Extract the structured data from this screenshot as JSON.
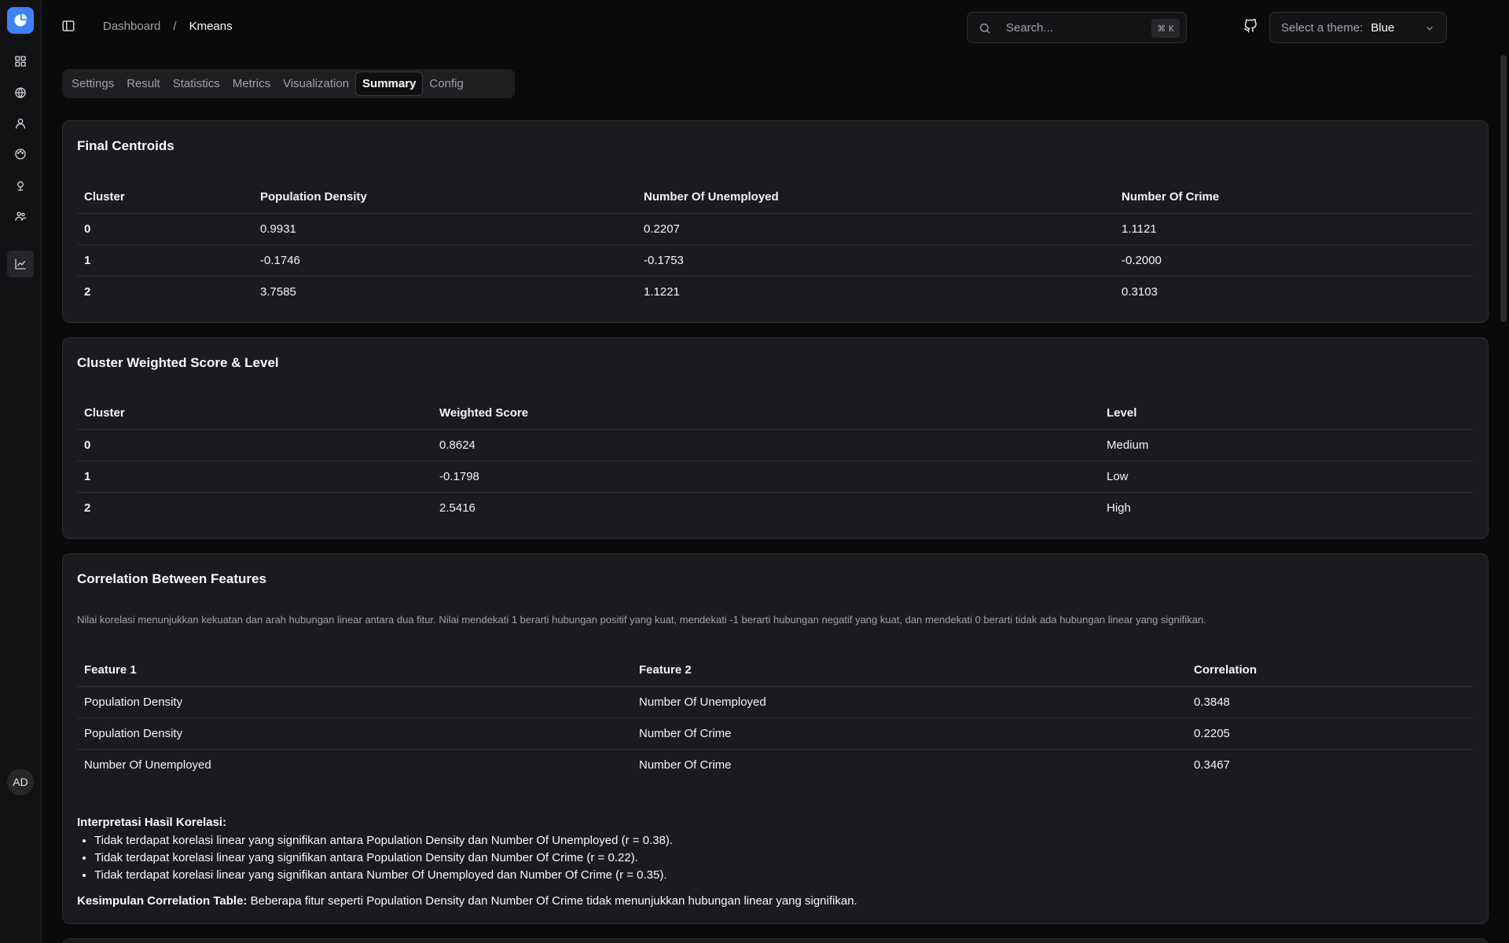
{
  "sidebar": {
    "nav": [
      "dashboard-icon",
      "globe-icon",
      "user-icon",
      "palette-icon",
      "map-pin-icon",
      "users-icon",
      "chart-line-icon"
    ],
    "avatar": "AD"
  },
  "header": {
    "breadcrumb": [
      "Dashboard",
      "Kmeans"
    ],
    "search_placeholder": "Search...",
    "search_kbd": "⌘ K",
    "theme_label": "Select a theme:",
    "theme_value": "Blue"
  },
  "tabs": [
    "Settings",
    "Result",
    "Statistics",
    "Metrics",
    "Visualization",
    "Summary",
    "Config"
  ],
  "active_tab": "Summary",
  "centroids": {
    "title": "Final Centroids",
    "headers": [
      "Cluster",
      "Population Density",
      "Number Of Unemployed",
      "Number Of Crime"
    ],
    "rows": [
      [
        "0",
        "0.9931",
        "0.2207",
        "1.1121"
      ],
      [
        "1",
        "-0.1746",
        "-0.1753",
        "-0.2000"
      ],
      [
        "2",
        "3.7585",
        "1.1221",
        "0.3103"
      ]
    ]
  },
  "weighted": {
    "title": "Cluster Weighted Score & Level",
    "headers": [
      "Cluster",
      "Weighted Score",
      "Level"
    ],
    "rows": [
      [
        "0",
        "0.8624",
        "Medium"
      ],
      [
        "1",
        "-0.1798",
        "Low"
      ],
      [
        "2",
        "2.5416",
        "High"
      ]
    ]
  },
  "correlation": {
    "title": "Correlation Between Features",
    "description": "Nilai korelasi menunjukkan kekuatan dan arah hubungan linear antara dua fitur. Nilai mendekati 1 berarti hubungan positif yang kuat, mendekati -1 berarti hubungan negatif yang kuat, dan mendekati 0 berarti tidak ada hubungan linear yang signifikan.",
    "headers": [
      "Feature 1",
      "Feature 2",
      "Correlation"
    ],
    "rows": [
      [
        "Population Density",
        "Number Of Unemployed",
        "0.3848"
      ],
      [
        "Population Density",
        "Number Of Crime",
        "0.2205"
      ],
      [
        "Number Of Unemployed",
        "Number Of Crime",
        "0.3467"
      ]
    ],
    "interpretation_heading": "Interpretasi Hasil Korelasi:",
    "interpretation": [
      "Tidak terdapat korelasi linear yang signifikan antara Population Density dan Number Of Unemployed (r = 0.38).",
      "Tidak terdapat korelasi linear yang signifikan antara Population Density dan Number Of Crime (r = 0.22).",
      "Tidak terdapat korelasi linear yang signifikan antara Number Of Unemployed dan Number Of Crime (r = 0.35)."
    ],
    "conclusion_label": "Kesimpulan Correlation Table:",
    "conclusion_text": " Beberapa fitur seperti Population Density dan Number Of Crime tidak menunjukkan hubungan linear yang signifikan."
  }
}
